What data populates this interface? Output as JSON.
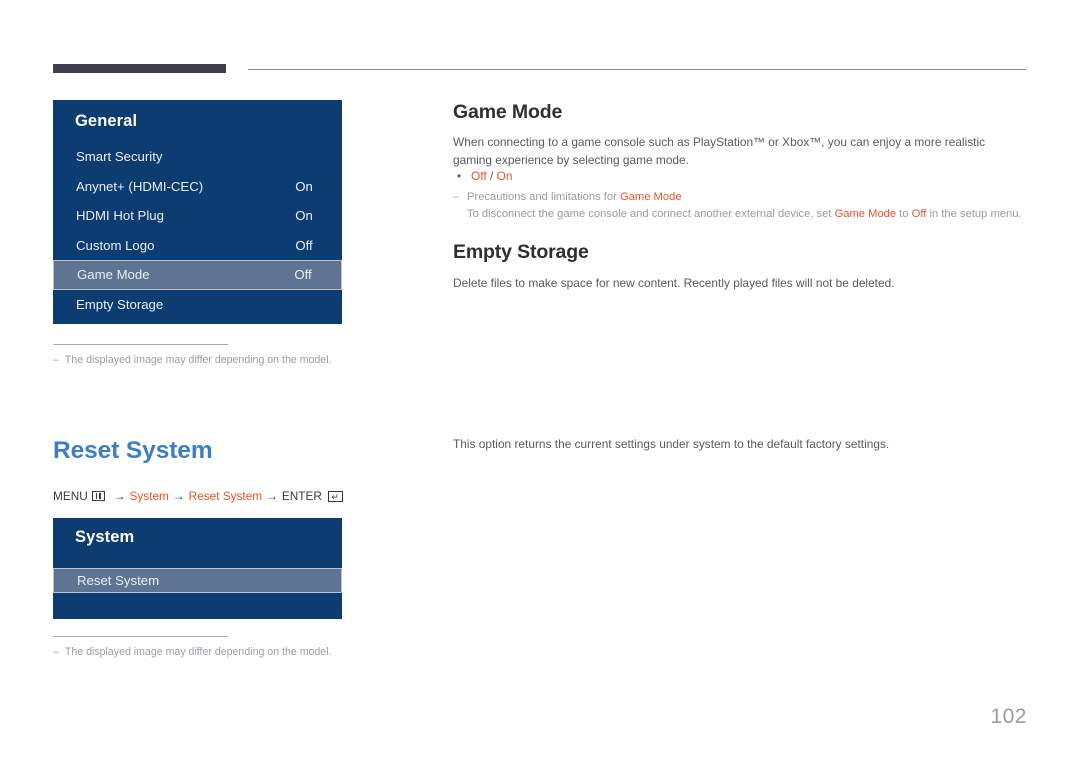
{
  "header": {
    "bar_color": "#433e4b",
    "rule_color": "#8c8c92"
  },
  "colors": {
    "osd_navy": "#0d3c70",
    "osd_selected": "#5e7492",
    "accent_orange": "#e8532a",
    "heading_blue": "#3c7fc4"
  },
  "osd_general": {
    "title": "General",
    "rows": [
      {
        "label": "Smart Security",
        "value": "",
        "selected": false
      },
      {
        "label": "Anynet+ (HDMI-CEC)",
        "value": "On",
        "selected": false
      },
      {
        "label": "HDMI Hot Plug",
        "value": "On",
        "selected": false
      },
      {
        "label": "Custom Logo",
        "value": "Off",
        "selected": false
      },
      {
        "label": "Game Mode",
        "value": "Off",
        "selected": true
      },
      {
        "label": "Empty Storage",
        "value": "",
        "selected": false
      }
    ]
  },
  "osd_system": {
    "title": "System",
    "rows": [
      {
        "label": "Reset System",
        "value": "",
        "selected": true
      },
      {
        "label": "",
        "value": "",
        "selected": false
      }
    ]
  },
  "footnote_top": {
    "dash": "–",
    "text": "The displayed image may differ depending on the model."
  },
  "footnote_bottom": {
    "dash": "–",
    "text": "The displayed image may differ depending on the model."
  },
  "reset_section": {
    "heading": "Reset System",
    "breadcrumb": {
      "menu_label": "MENU",
      "menu_icon": "menu-grid-icon",
      "arrow": "→",
      "step1": "System",
      "step2": "Reset System",
      "enter_label": "ENTER",
      "enter_icon": "enter-key-icon"
    },
    "description": "This option returns the current settings under system to the default factory settings."
  },
  "game_mode": {
    "heading": "Game Mode",
    "paragraph": "When connecting to a game console such as PlayStation™ or Xbox™, you can enjoy a more realistic gaming experience by selecting game mode.",
    "bullet_dot": "•",
    "option_off": "Off",
    "option_sep": " / ",
    "option_on": "On",
    "note_tilde": "‒",
    "note_lead": "Precautions and limitations for ",
    "note_lead_term": "Game Mode",
    "note_sub_a": "To disconnect the game console and connect another external device, set ",
    "note_sub_term1": "Game Mode",
    "note_sub_b": " to ",
    "note_sub_term2": "Off",
    "note_sub_c": " in the setup menu."
  },
  "empty_storage": {
    "heading": "Empty Storage",
    "paragraph": "Delete files to make space for new content. Recently played files will not be deleted."
  },
  "page_number": "102"
}
